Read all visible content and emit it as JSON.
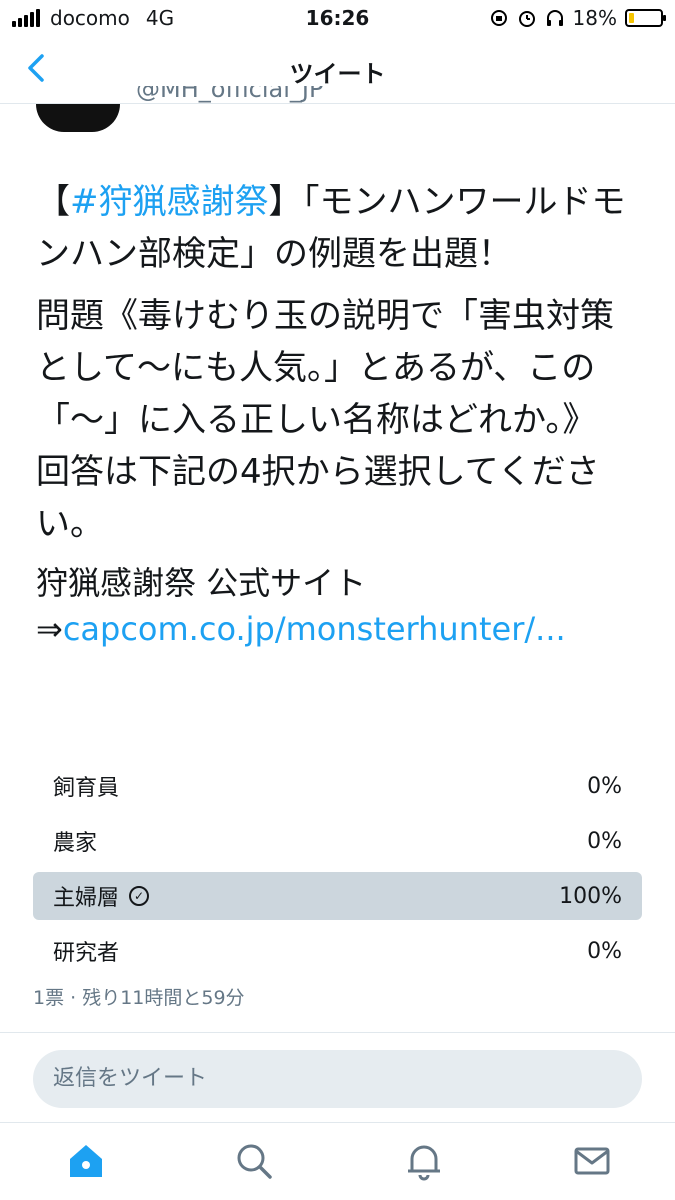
{
  "status_bar": {
    "carrier": "docomo",
    "network": "4G",
    "time": "16:26",
    "battery_percent": "18%",
    "battery_level": 0.18,
    "icons": [
      "rotation-lock-icon",
      "alarm-icon",
      "headphones-icon"
    ]
  },
  "nav": {
    "title": "ツイート",
    "back_icon": "chevron-left-icon"
  },
  "tweet": {
    "handle": "@MH_official_JP",
    "paragraph1_prefix": "【",
    "hashtag": "#狩猟感謝祭",
    "paragraph1_rest": "】「モンハンワールドモンハン部検定」の例題を出題！",
    "paragraph2": "問題《毒けむり玉の説明で「害虫対策として〜にも人気。」とあるが、この「〜」に入る正しい名称はどれか。》",
    "paragraph3": "回答は下記の4択から選択してください。",
    "site_label": "狩猟感謝祭 公式サイト",
    "arrow": "⇒",
    "link": "capcom.co.jp/monsterhunter/..."
  },
  "poll": {
    "options": [
      {
        "label": "飼育員",
        "percent": "0%"
      },
      {
        "label": "農家",
        "percent": "0%"
      },
      {
        "label": "主婦層",
        "percent": "100%",
        "selected": true
      },
      {
        "label": "研究者",
        "percent": "0%"
      }
    ],
    "meta": "1票 · 残り11時間と59分"
  },
  "reply": {
    "placeholder": "返信をツイート"
  },
  "tabbar": {
    "tabs": [
      "home-icon",
      "search-icon",
      "notifications-icon",
      "messages-icon"
    ],
    "active_color": "#1da1f2",
    "inactive_color": "#657786"
  }
}
